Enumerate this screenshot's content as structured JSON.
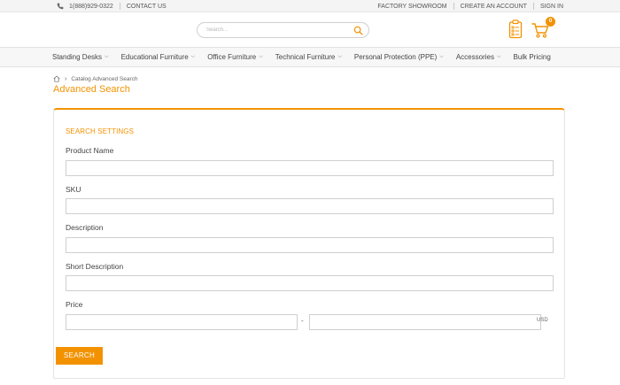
{
  "topbar": {
    "phone": "1(888)929-0322",
    "contact": "CONTACT US",
    "links": [
      "FACTORY SHOWROOM",
      "CREATE AN ACCOUNT",
      "SIGN IN"
    ]
  },
  "header": {
    "search_placeholder": "Search...",
    "cart_count": "0"
  },
  "nav": {
    "items": [
      {
        "label": "Standing Desks",
        "has_dropdown": true
      },
      {
        "label": "Educational Furniture",
        "has_dropdown": true
      },
      {
        "label": "Office Furniture",
        "has_dropdown": true
      },
      {
        "label": "Technical Furniture",
        "has_dropdown": true
      },
      {
        "label": "Personal Protection (PPE)",
        "has_dropdown": true
      },
      {
        "label": "Accessories",
        "has_dropdown": true
      },
      {
        "label": "Bulk Pricing",
        "has_dropdown": false
      }
    ]
  },
  "breadcrumb": {
    "current": "Catalog Advanced Search"
  },
  "page": {
    "title": "Advanced Search"
  },
  "form": {
    "section_title": "SEARCH SETTINGS",
    "fields": {
      "product_name": "Product Name",
      "sku": "SKU",
      "description": "Description",
      "short_description": "Short Description",
      "price": "Price"
    },
    "price_separator": "-",
    "currency": "USD",
    "submit_label": "SEARCH"
  },
  "colors": {
    "accent": "#f39200",
    "border": "#cfcfcf"
  },
  "icons": [
    "phone-icon",
    "search-icon",
    "clipboard-icon",
    "cart-icon",
    "home-icon",
    "chevron-down-icon",
    "chevron-right-icon"
  ]
}
